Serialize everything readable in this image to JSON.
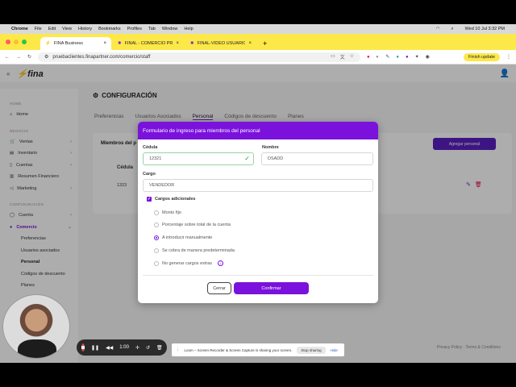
{
  "menubar": {
    "app": "Chrome",
    "items": [
      "File",
      "Edit",
      "View",
      "History",
      "Bookmarks",
      "Profiles",
      "Tab",
      "Window",
      "Help"
    ],
    "clock": "Wed 10 Jul  3:32 PM"
  },
  "tabs": [
    {
      "label": "FINA Business",
      "active": true
    },
    {
      "label": "FINAL - COMERCIO PREFER",
      "active": false
    },
    {
      "label": "FINAL-VIDEO USUARIOS AS",
      "active": false
    }
  ],
  "urlbar": {
    "url": "pruebaclientes.finapartner.com/comercio/staff",
    "finish_update": "Finish update"
  },
  "app": {
    "logo": "fina",
    "sidebar": {
      "sections": [
        {
          "title": "HOME",
          "items": [
            {
              "label": "Home"
            }
          ]
        },
        {
          "title": "NEGOCIO",
          "items": [
            {
              "label": "Ventas"
            },
            {
              "label": "Inventario"
            },
            {
              "label": "Cuentas"
            },
            {
              "label": "Resumen Financiero"
            },
            {
              "label": "Marketing"
            }
          ]
        },
        {
          "title": "CONFIGURACIÓN",
          "items": [
            {
              "label": "Cuenta"
            },
            {
              "label": "Comercio"
            }
          ]
        }
      ],
      "sub_items": [
        "Preferencias",
        "Usuarios asociados",
        "Personal",
        "Códigos de descuento",
        "Planes"
      ]
    },
    "page_title": "CONFIGURACIÓN",
    "tabs": [
      "Preferencias",
      "Usuarios Asociados",
      "Personal",
      "Códigos de descuento",
      "Planes"
    ],
    "card_label": "Miembros del p",
    "add_button": "Agregar personal",
    "table_header": "Cédula",
    "table_value": "1323",
    "footer": "Privacy Policy · Terms & Conditions"
  },
  "modal": {
    "title": "Formulario de ingreso para miembros del personal",
    "cedula_label": "Cédula",
    "cedula_value": "12321",
    "nombre_label": "Nombre",
    "nombre_value": "DSADD",
    "cargo_label": "Cargo",
    "cargo_value": "VENDEDOR",
    "cargos_label": "Cargos adicionales",
    "options": [
      "Monto fijo",
      "Porcentaje sobre total de la cuenta",
      "A introducir manualmente",
      "Se cobra de manera predeterminada",
      "No generar cargos extras"
    ],
    "selected_option": "A introducir manualmente",
    "cancel": "Cerrar",
    "confirm": "Confirmar"
  },
  "loom": {
    "timer": "1:00",
    "share_text": "Loom – Screen Recorder & Screen Capture is sharing your screen.",
    "stop": "Stop sharing",
    "hide": "Hide"
  },
  "colors": {
    "accent": "#7a12dc",
    "tabbar": "#fde84a"
  }
}
